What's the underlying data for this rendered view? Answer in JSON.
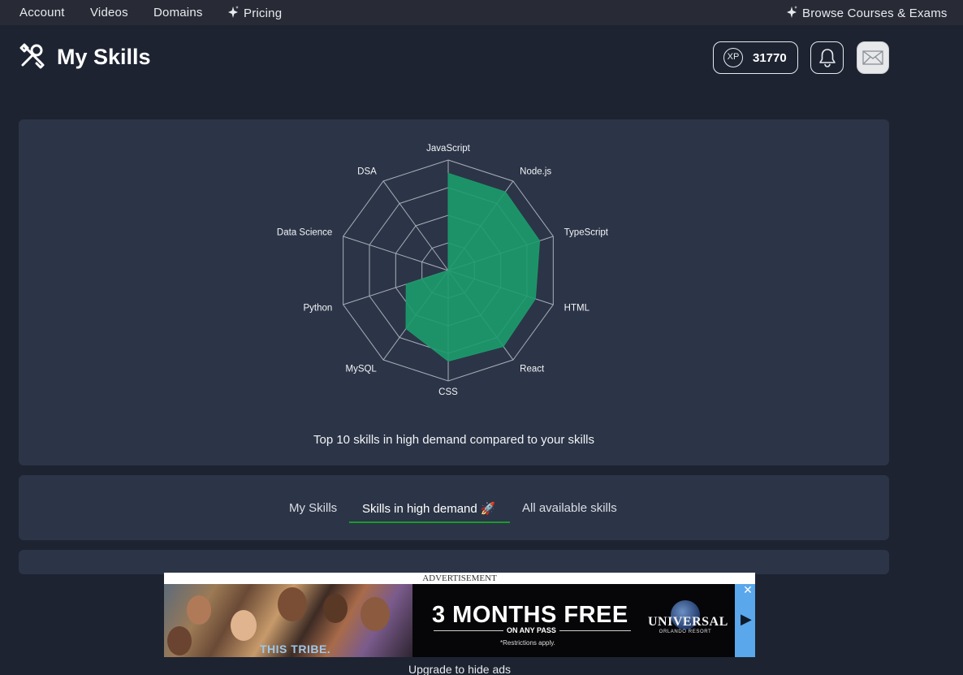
{
  "nav": {
    "account": "Account",
    "videos": "Videos",
    "domains": "Domains",
    "pricing": "Pricing",
    "browse": "Browse Courses & Exams"
  },
  "header": {
    "title": "My Skills",
    "xp_badge": "XP",
    "xp_value": "31770"
  },
  "chart_data": {
    "type": "radar",
    "axes": [
      "JavaScript",
      "Node.js",
      "TypeScript",
      "HTML",
      "React",
      "CSS",
      "MySQL",
      "Python",
      "Data Science",
      "DSA"
    ],
    "rings": 4,
    "max": 1,
    "values": [
      0.88,
      0.88,
      0.87,
      0.83,
      0.85,
      0.82,
      0.65,
      0.4,
      0.0,
      0.0
    ],
    "fill_color": "#1c9b6b",
    "grid_color": "#a7adb9",
    "caption": "Top 10 skills in high demand compared to your skills"
  },
  "tabs": [
    {
      "label": "My Skills"
    },
    {
      "label": "Skills in high demand 🚀"
    },
    {
      "label": "All available skills"
    }
  ],
  "active_tab": 1,
  "ad": {
    "label": "ADVERTISEMENT",
    "tagline": "THIS TRIBE.",
    "headline": "3 MONTHS FREE",
    "subline": "ON ANY PASS",
    "fineprint": "*Restrictions apply.",
    "brand": "UNIVERSAL",
    "brand_sub": "ORLANDO RESORT",
    "close": "✕",
    "arrow": "▶",
    "upgrade": "Upgrade to hide ads"
  }
}
